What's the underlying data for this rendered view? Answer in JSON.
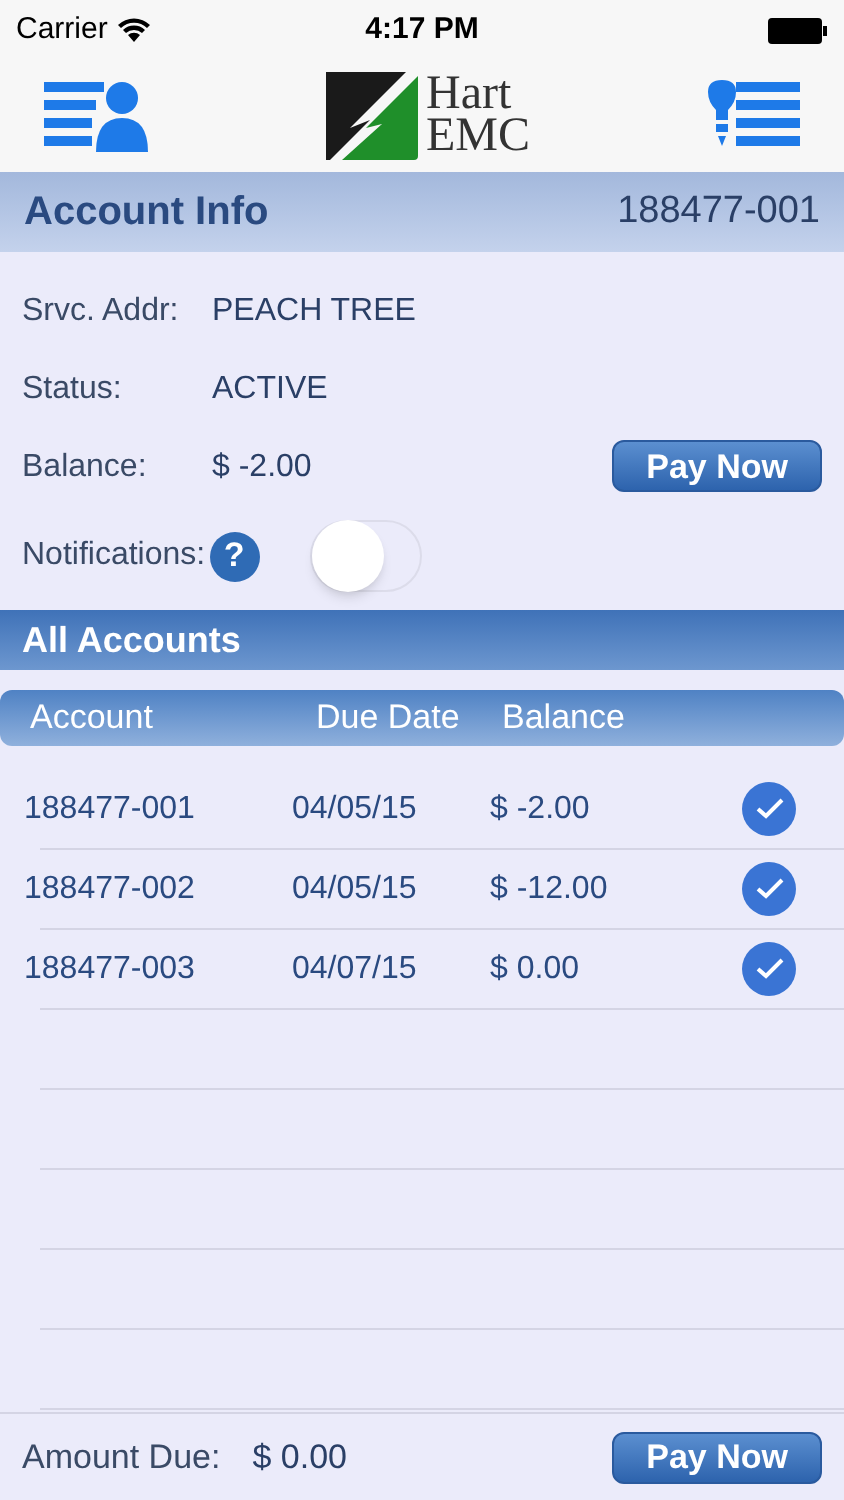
{
  "status_bar": {
    "carrier": "Carrier",
    "time": "4:17 PM"
  },
  "logo": {
    "line_1": "Hart",
    "line_2": "EMC"
  },
  "account_info": {
    "title": "Account Info",
    "account_number": "188477-001",
    "fields": [
      {
        "label": "Srvc. Addr:",
        "value": "PEACH TREE"
      },
      {
        "label": "Status:",
        "value": "ACTIVE"
      },
      {
        "label": "Balance:",
        "value": "$ -2.00"
      }
    ],
    "pay_button": "Pay Now",
    "notifications": {
      "label": "Notifications:",
      "help": "?",
      "on": false
    }
  },
  "all_accounts": {
    "title": "All Accounts",
    "columns": [
      "Account",
      "Due Date",
      "Balance"
    ],
    "rows": [
      {
        "account": "188477-001",
        "due_date": "04/05/15",
        "balance": "$ -2.00",
        "checked": true
      },
      {
        "account": "188477-002",
        "due_date": "04/05/15",
        "balance": "$ -12.00",
        "checked": true
      },
      {
        "account": "188477-003",
        "due_date": "04/07/15",
        "balance": "$ 0.00",
        "checked": true
      }
    ]
  },
  "footer": {
    "label": "Amount Due:",
    "value": "$ 0.00",
    "pay_button": "Pay Now"
  }
}
